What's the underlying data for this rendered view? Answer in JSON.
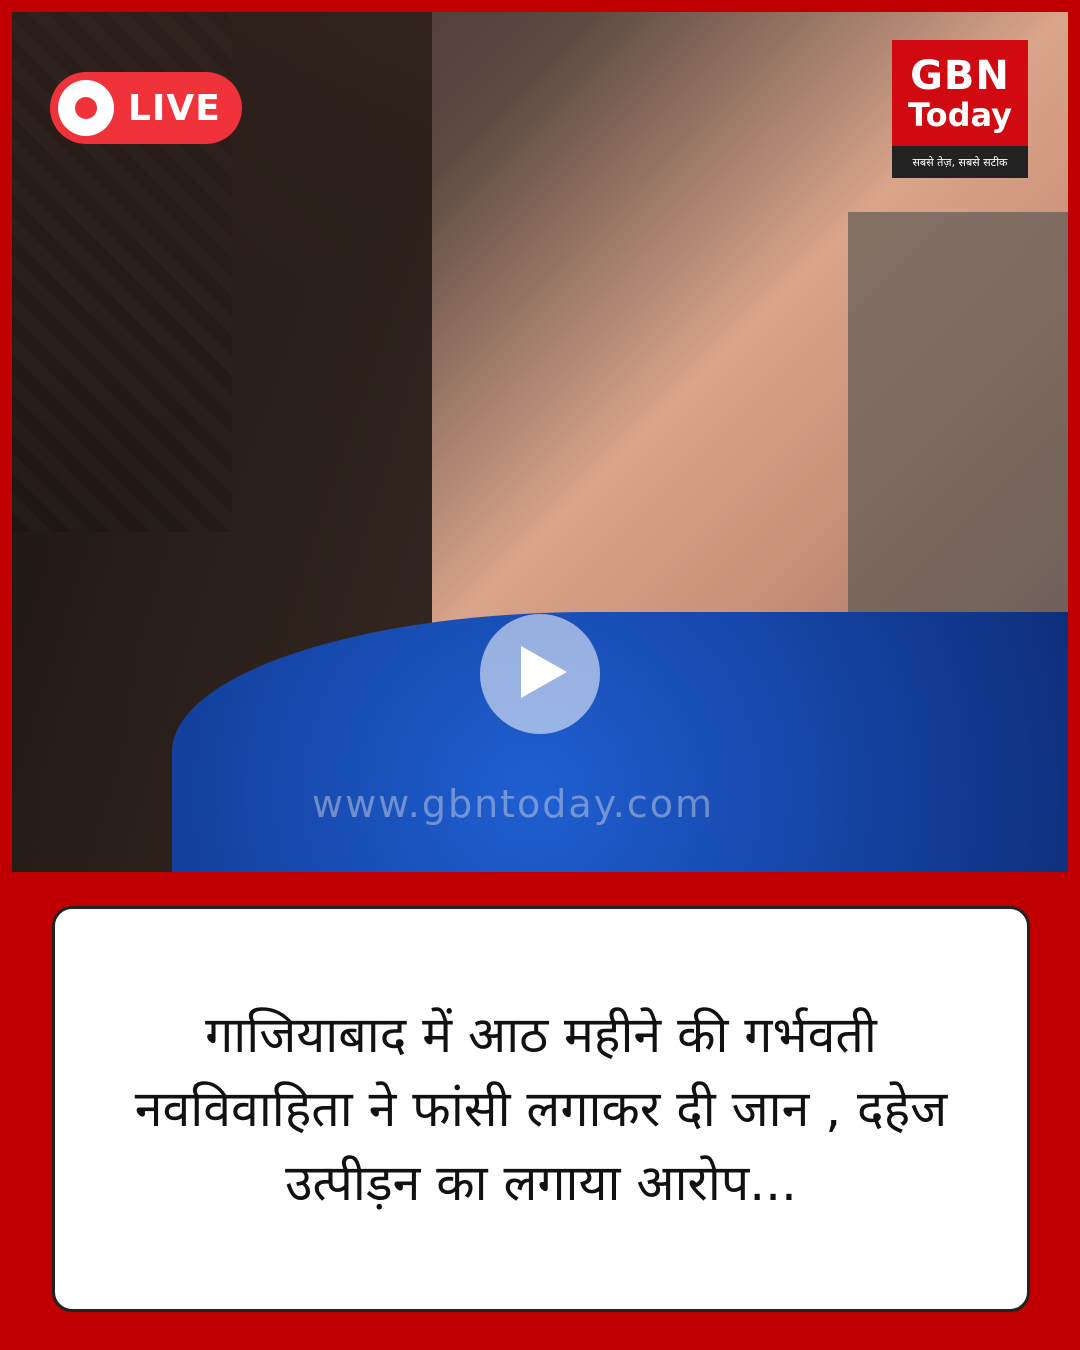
{
  "live_badge": {
    "label": "LIVE",
    "color": "#f0323a"
  },
  "logo": {
    "line1": "GBN",
    "line2": "Today",
    "tagline": "सबसे तेज़, सबसे सटीक",
    "color": "#d10a12"
  },
  "media": {
    "watermark": "www.gbntoday.com",
    "play_icon": "play-icon"
  },
  "headline": {
    "text": "गाजियाबाद में आठ महीने की गर्भवती नवविवाहिता ने फांसी लगाकर दी जान , दहेज उत्पीड़न का लगाया आरोप..."
  },
  "colors": {
    "frame": "#c00000",
    "card": "#ffffff"
  }
}
